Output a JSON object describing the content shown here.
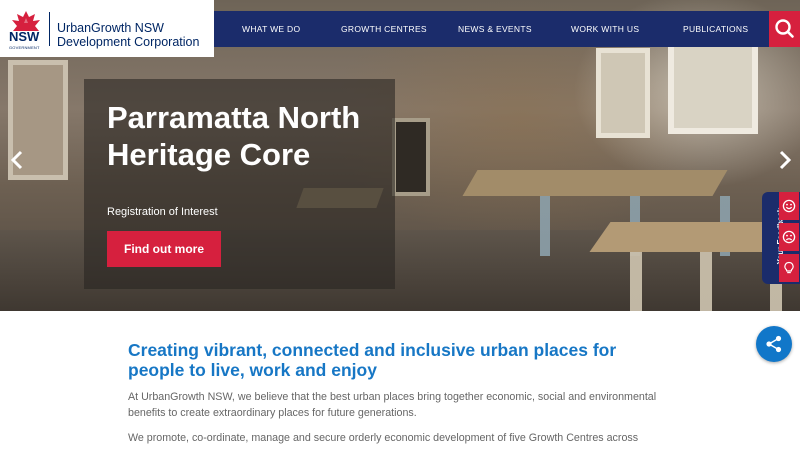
{
  "header": {
    "logo_text": "NSW",
    "logo_subtext": "GOVERNMENT",
    "org_name_line1": "UrbanGrowth NSW",
    "org_name_line2": "Development Corporation"
  },
  "nav": {
    "items": [
      {
        "label": "WHAT WE DO"
      },
      {
        "label": "GROWTH CENTRES"
      },
      {
        "label": "NEWS & EVENTS"
      },
      {
        "label": "WORK WITH US"
      },
      {
        "label": "PUBLICATIONS"
      }
    ],
    "search_icon": "search-icon"
  },
  "hero": {
    "title": "Parramatta North Heritage Core",
    "subtitle": "Registration of Interest",
    "cta_label": "Find out more",
    "prev_icon": "chevron-left-icon",
    "next_icon": "chevron-right-icon"
  },
  "feedback": {
    "label": "Your Feedback",
    "buttons": [
      {
        "icon": "smile-icon"
      },
      {
        "icon": "frown-icon"
      },
      {
        "icon": "lightbulb-icon"
      }
    ]
  },
  "share": {
    "icon": "share-icon"
  },
  "content": {
    "heading": "Creating vibrant, connected and inclusive urban places for people to live, work and enjoy",
    "paragraph1": "At UrbanGrowth NSW, we believe that the best urban places bring together economic, social and environmental benefits to create extraordinary places for future generations.",
    "paragraph2": "We promote, co-ordinate, manage and secure orderly economic development of five Growth Centres across"
  },
  "colors": {
    "navy": "#1b2c6b",
    "red": "#d6203e",
    "blue": "#1777c5"
  }
}
